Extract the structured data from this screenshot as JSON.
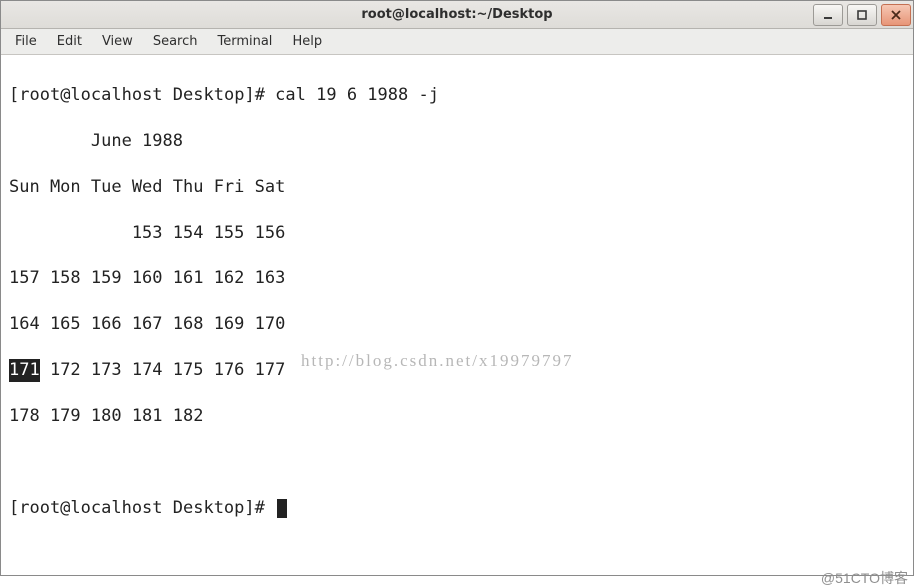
{
  "window": {
    "title": "root@localhost:~/Desktop"
  },
  "menu": {
    "items": [
      "File",
      "Edit",
      "View",
      "Search",
      "Terminal",
      "Help"
    ]
  },
  "terminal": {
    "prompt_user": "root@localhost",
    "prompt_cwd": "Desktop",
    "command": "cal 19 6 1988 -j",
    "cal_title_spaced": "        June 1988",
    "day_header": "Sun Mon Tue Wed Thu Fri Sat",
    "rows": [
      "            153 154 155 156",
      "157 158 159 160 161 162 163",
      "164 165 166 167 168 169 170"
    ],
    "row_highlight_cell": "171",
    "row_highlight_rest": " 172 173 174 175 176 177",
    "row_last": "178 179 180 181 182",
    "blank": " ",
    "prompt2_full": "[root@localhost Desktop]# "
  },
  "watermarks": {
    "url": "http://blog.csdn.net/x19979797",
    "corner": "@51CTO博客"
  },
  "icons": {
    "minimize": "minimize-icon",
    "maximize": "maximize-icon",
    "close": "close-icon"
  }
}
